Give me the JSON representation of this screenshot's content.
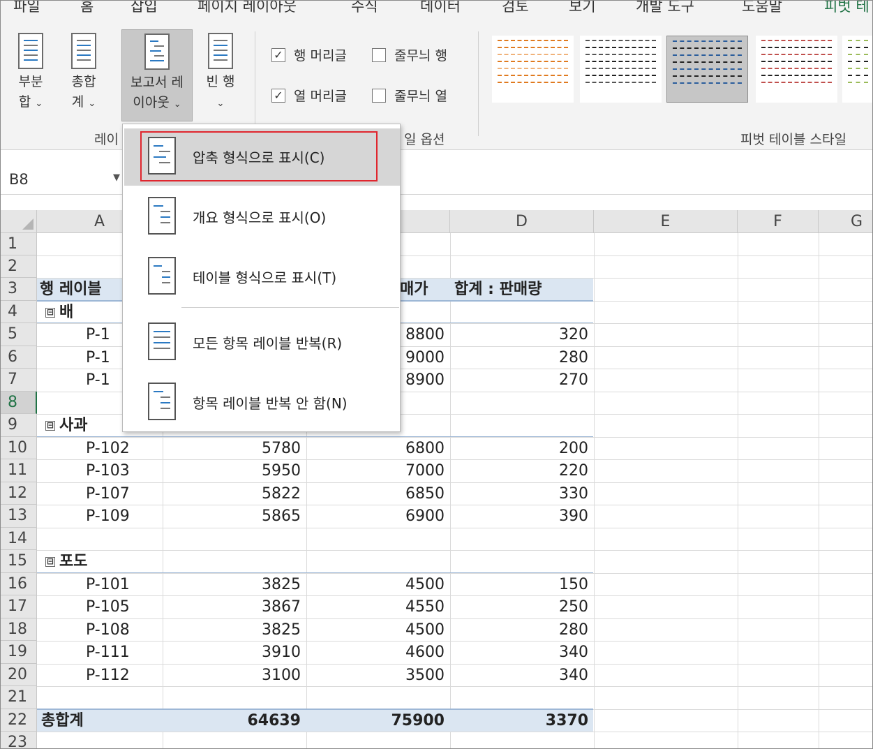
{
  "menu_tabs": [
    "파일",
    "홈",
    "삽입",
    "페이지 레이아웃",
    "수식",
    "데이터",
    "검토",
    "보기",
    "개발 도구",
    "도움말",
    "피벗 테"
  ],
  "ribbon": {
    "subtotal": {
      "line1": "부분",
      "line2": "합"
    },
    "grand_total": {
      "line1": "총합",
      "line2": "계"
    },
    "report_layout": {
      "line1": "보고서 레",
      "line2": "이아웃"
    },
    "blank_rows": {
      "line1": "빈 행"
    },
    "layout_group_label": "레이",
    "row_headers": "행 머리글",
    "col_headers": "열 머리글",
    "banded_rows": "줄무늬 행",
    "banded_cols": "줄무늬 열",
    "style_options_label": "일 옵션",
    "styles_label": "피벗 테이블 스타일",
    "chevron": "⌄",
    "check": "✓"
  },
  "namebox": {
    "value": "B8",
    "dropdown": "▼"
  },
  "columns": [
    "A",
    "B",
    "C",
    "D",
    "E",
    "F",
    "G"
  ],
  "rows": [
    "1",
    "2",
    "3",
    "4",
    "5",
    "6",
    "7",
    "8",
    "9",
    "10",
    "11",
    "12",
    "13",
    "14",
    "15",
    "16",
    "17",
    "18",
    "19",
    "20",
    "21",
    "22",
    "23"
  ],
  "sheet": {
    "header_a": "행 레이블",
    "header_c": "매가",
    "header_d": "합계 : 판매량",
    "g1": "배",
    "g1_rows": [
      {
        "a": "P-1",
        "c": "8800",
        "d": "320"
      },
      {
        "a": "P-1",
        "c": "9000",
        "d": "280"
      },
      {
        "a": "P-1",
        "c": "8900",
        "d": "270"
      }
    ],
    "g2": "사과",
    "g2_rows": [
      {
        "a": "P-102",
        "b": "5780",
        "c": "6800",
        "d": "200"
      },
      {
        "a": "P-103",
        "b": "5950",
        "c": "7000",
        "d": "220"
      },
      {
        "a": "P-107",
        "b": "5822",
        "c": "6850",
        "d": "330"
      },
      {
        "a": "P-109",
        "b": "5865",
        "c": "6900",
        "d": "390"
      }
    ],
    "g3": "포도",
    "g3_rows": [
      {
        "a": "P-101",
        "b": "3825",
        "c": "4500",
        "d": "150"
      },
      {
        "a": "P-105",
        "b": "3867",
        "c": "4550",
        "d": "250"
      },
      {
        "a": "P-108",
        "b": "3825",
        "c": "4500",
        "d": "280"
      },
      {
        "a": "P-111",
        "b": "3910",
        "c": "4600",
        "d": "340"
      },
      {
        "a": "P-112",
        "b": "3100",
        "c": "3500",
        "d": "340"
      }
    ],
    "total_label": "총합계",
    "total_b": "64639",
    "total_c": "75900",
    "total_d": "3370",
    "collapse": "⊟"
  },
  "dropdown": {
    "items": [
      "압축 형식으로 표시(C)",
      "개요 형식으로 표시(O)",
      "테이블 형식으로 표시(T)",
      "모든 항목 레이블 반복(R)",
      "항목 레이블 반복 안 함(N)"
    ]
  },
  "colors": {
    "accent": "#217346",
    "highlight_box": "#e0262e",
    "pivot_band": "#dbe6f2"
  }
}
